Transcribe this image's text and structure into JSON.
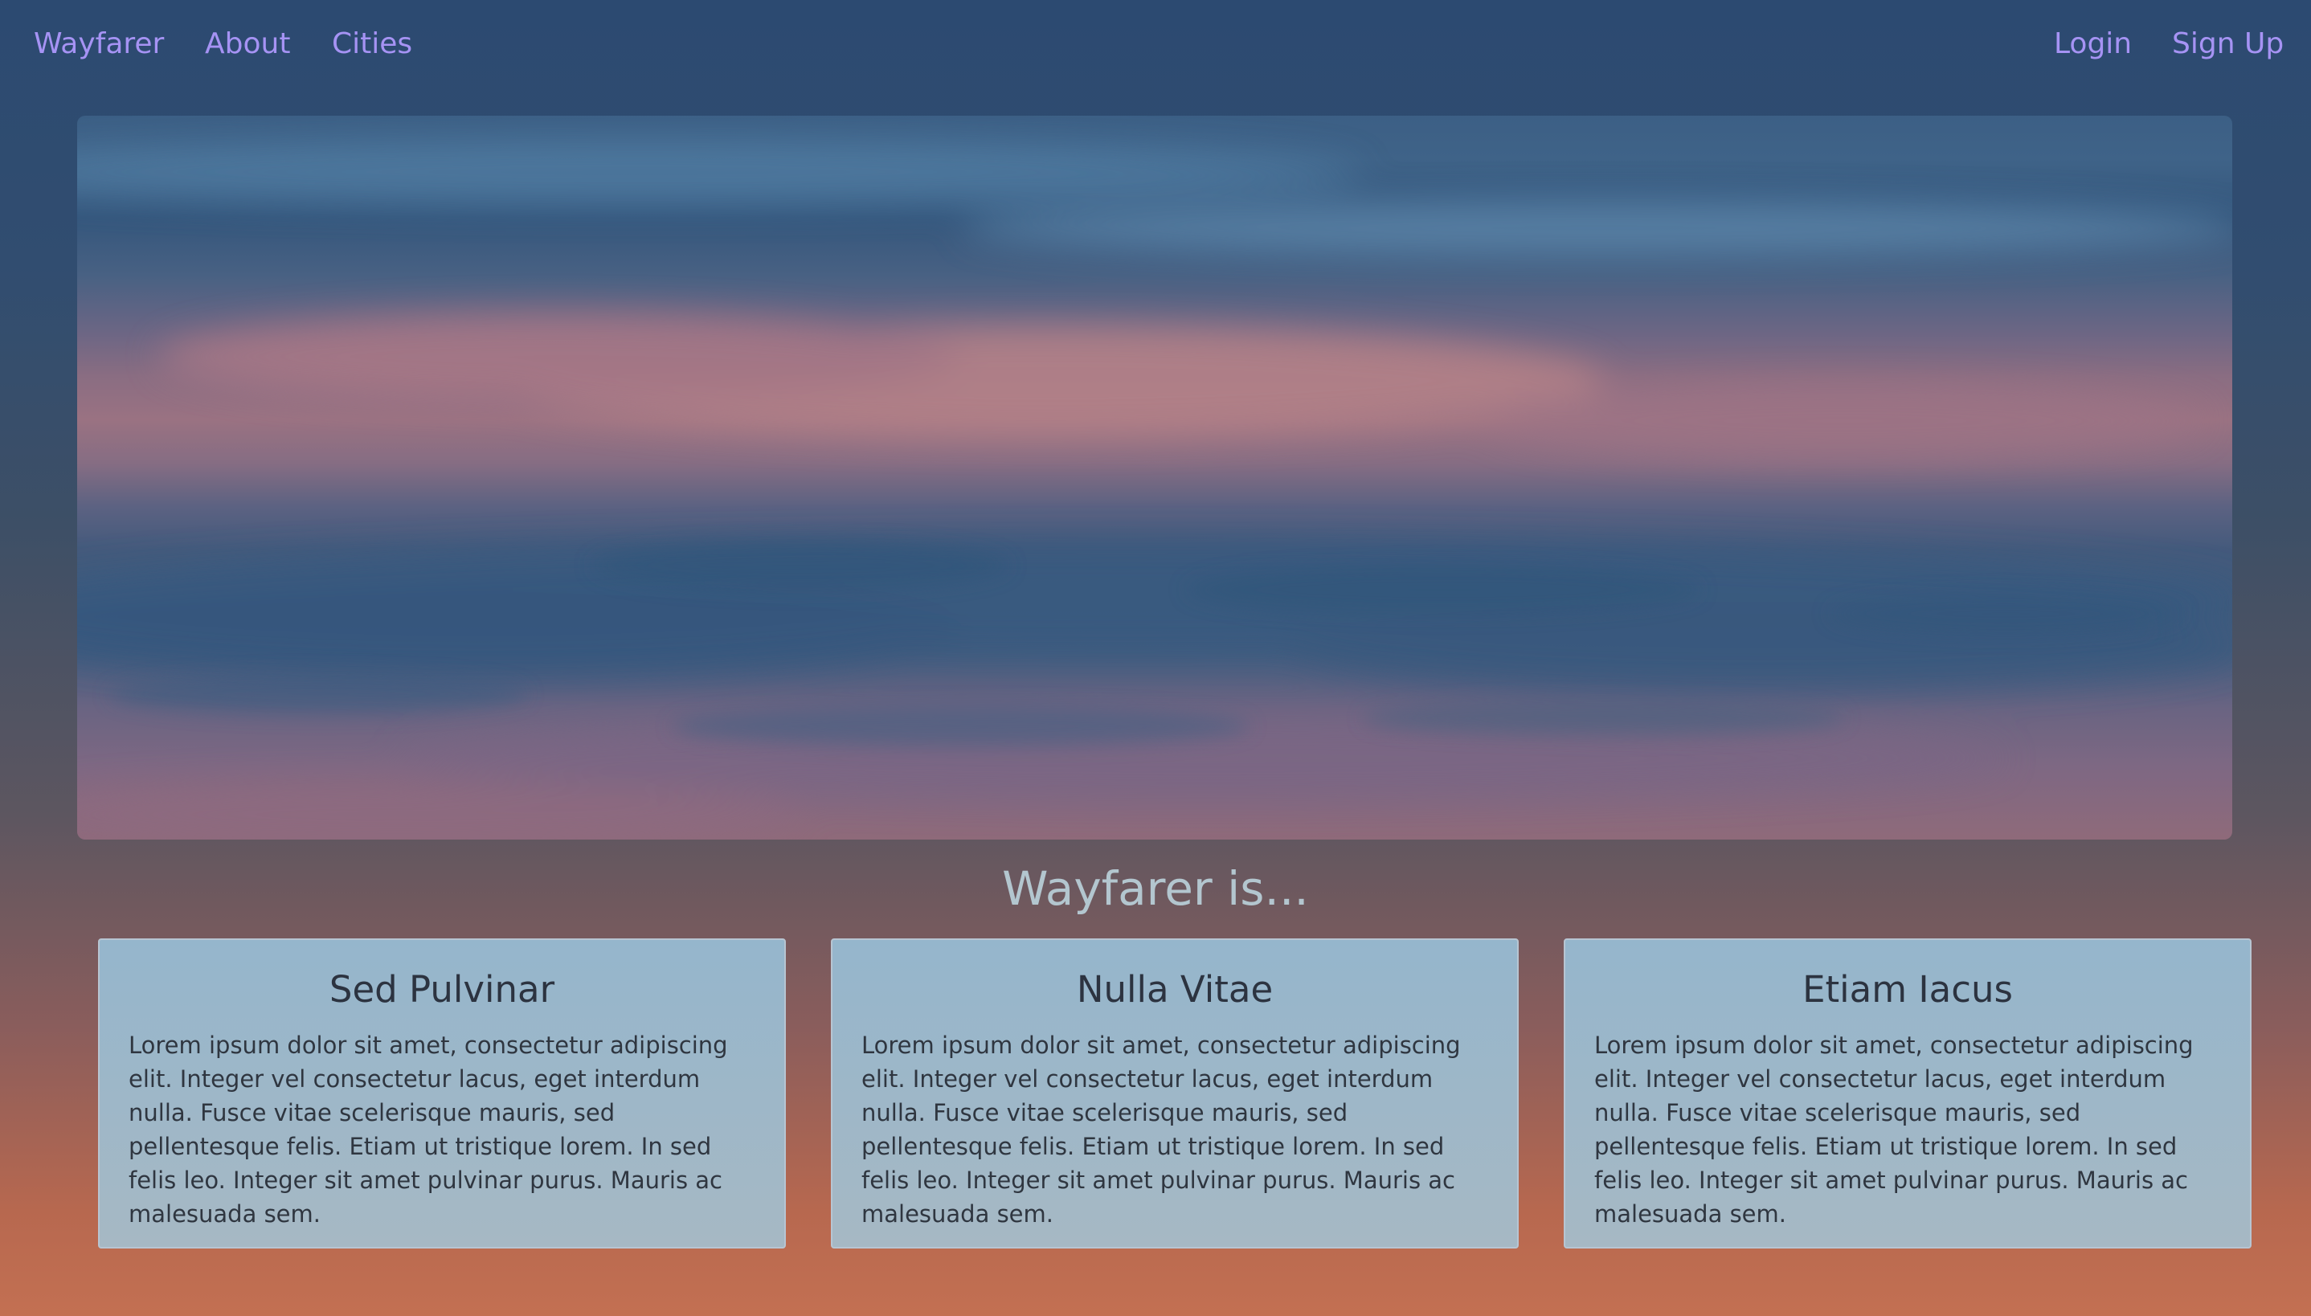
{
  "nav": {
    "brand": "Wayfarer",
    "about": "About",
    "cities": "Cities",
    "login": "Login",
    "signup": "Sign Up"
  },
  "hero": {
    "image": "sunset-clouds-photo"
  },
  "section": {
    "heading": "Wayfarer is..."
  },
  "cards": [
    {
      "title": "Sed Pulvinar",
      "body": "Lorem ipsum dolor sit amet, consectetur adipiscing elit. Integer vel consectetur lacus, eget interdum nulla. Fusce vitae scelerisque mauris, sed pellentesque felis. Etiam ut tristique lorem. In sed felis leo. Integer sit amet pulvinar purus. Mauris ac malesuada sem."
    },
    {
      "title": "Nulla Vitae",
      "body": "Lorem ipsum dolor sit amet, consectetur adipiscing elit. Integer vel consectetur lacus, eget interdum nulla. Fusce vitae scelerisque mauris, sed pellentesque felis. Etiam ut tristique lorem. In sed felis leo. Integer sit amet pulvinar purus. Mauris ac malesuada sem."
    },
    {
      "title": "Etiam Iacus",
      "body": "Lorem ipsum dolor sit amet, consectetur adipiscing elit. Integer vel consectetur lacus, eget interdum nulla. Fusce vitae scelerisque mauris, sed pellentesque felis. Etiam ut tristique lorem. In sed felis leo. Integer sit amet pulvinar purus. Mauris ac malesuada sem."
    }
  ],
  "colors": {
    "nav_link": "#a693f4",
    "card_background": "#9fb8c9",
    "heading": "#b3c6cf"
  }
}
